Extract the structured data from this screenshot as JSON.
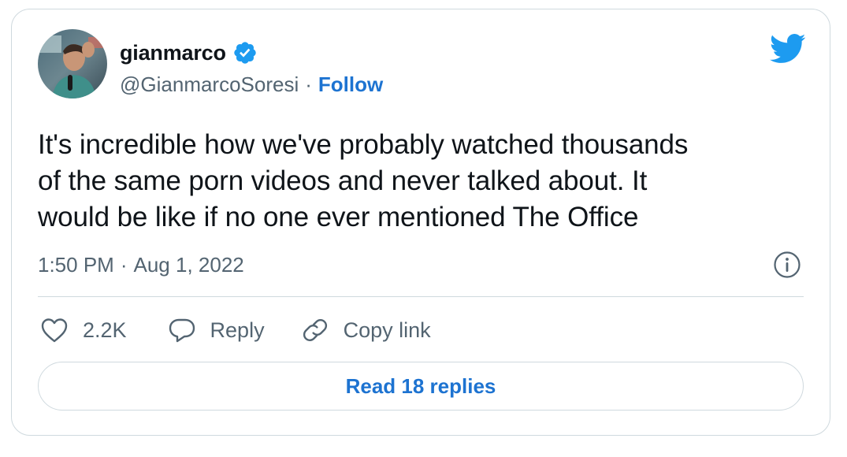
{
  "author": {
    "display_name": "gianmarco",
    "verified": true,
    "handle": "@GianmarcoSoresi",
    "separator": "·",
    "follow_label": "Follow"
  },
  "tweet": {
    "text": "It's incredible how we've probably watched thousands\nof the same porn videos and never talked about. It\nwould be like if no one ever mentioned The Office",
    "time": "1:50 PM",
    "separator": "·",
    "date": "Aug 1, 2022"
  },
  "actions": {
    "like_count": "2.2K",
    "reply_label": "Reply",
    "copy_link_label": "Copy link"
  },
  "read_replies_label": "Read 18 replies",
  "icons": {
    "brand": "twitter-bird-icon",
    "verified": "verified-badge-icon",
    "info": "info-icon",
    "like": "heart-icon",
    "reply": "speech-bubble-icon",
    "copy_link": "link-icon"
  },
  "colors": {
    "twitter_blue": "#1d9bf0",
    "link_blue": "#1d73d1",
    "text": "#0f1419",
    "secondary_text": "#536471",
    "border": "#cfd9de"
  }
}
